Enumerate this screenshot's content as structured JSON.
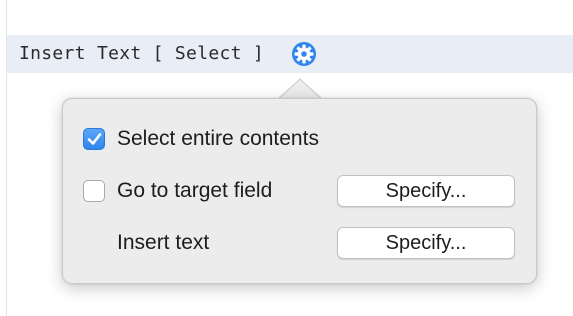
{
  "script_step": {
    "text": "Insert Text [ Select ]",
    "options_icon": "gear-icon",
    "highlight_color": "#e8edf6"
  },
  "popover": {
    "select_entire_contents": {
      "label": "Select entire contents",
      "checked": true
    },
    "go_to_target_field": {
      "label": "Go to target field",
      "checked": false,
      "button_label": "Specify..."
    },
    "insert_text": {
      "label": "Insert text",
      "button_label": "Specify..."
    }
  },
  "colors": {
    "accent": "#2f86ee",
    "popover_background": "#ececec"
  }
}
